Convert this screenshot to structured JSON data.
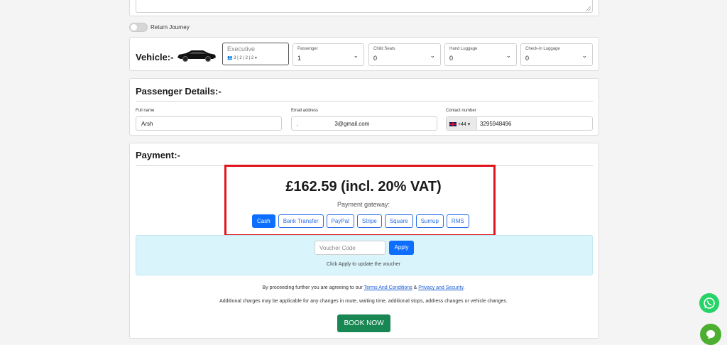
{
  "return_journey": {
    "label": "Return Journey",
    "enabled": false
  },
  "vehicle": {
    "heading": "Vehicle:-",
    "type": {
      "value": "Executive",
      "meta": "3 | 2 | 2 | 2"
    },
    "fields": [
      {
        "label": "Passenger",
        "value": "1"
      },
      {
        "label": "Child Seats",
        "value": "0"
      },
      {
        "label": "Hand Luggage",
        "value": "0"
      },
      {
        "label": "Check-in Luggage",
        "value": "0"
      }
    ]
  },
  "passenger": {
    "heading": "Passenger Details:-",
    "full_name": {
      "label": "Full name",
      "value": "Arsh"
    },
    "email": {
      "label": "Email address",
      "value": ".                       3@gmail.com"
    },
    "contact": {
      "label": "Contact number",
      "prefix": "+44",
      "value": "3295948496"
    }
  },
  "payment": {
    "heading": "Payment:-",
    "price": "£162.59 (incl. 20% VAT)",
    "gateway_label": "Payment gateway:",
    "gateways": [
      "Cash",
      "Bank Transfer",
      "PayPal",
      "Stripe",
      "Square",
      "Sumup",
      "RMS"
    ],
    "selected_gateway": "Cash",
    "voucher_placeholder": "Voucher Code",
    "apply_label": "Apply",
    "voucher_hint": "Click Apply to update the voucher",
    "terms_prefix": "By proceeding further you are agreeing to our",
    "terms_link": "Terms And Conditions",
    "terms_amp": "&",
    "privacy_link": "Privacy and Security",
    "terms_suffix": ".",
    "additional": "Additional charges may be applicable for any changes in route, waiting time, additional stops, address changes or vehicle changes.",
    "book_label": "BOOK NOW"
  },
  "colors": {
    "primary": "#0d6efd",
    "success": "#198754",
    "highlight": "#e0161c",
    "voucher_bg": "#d9f5fb"
  }
}
